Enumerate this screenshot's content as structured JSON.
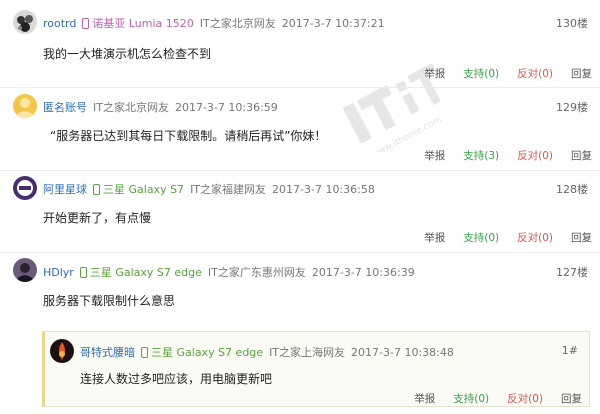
{
  "comments": [
    {
      "user": "rootrd",
      "device": "诺基亚 Lumia 1520",
      "source": "IT之家北京网友",
      "time": "2017-3-7 10:37:21",
      "floor": "130楼",
      "text": "我的一大堆演示机怎么检查不到",
      "report": "举报",
      "support": "支持(0)",
      "oppose": "反对(0)",
      "reply": "回复"
    },
    {
      "user": "匿名账号",
      "device": "",
      "source": "IT之家北京网友",
      "time": "2017-3-7 10:36:59",
      "floor": "129楼",
      "text": "“服务器已达到其每日下载限制。请稍后再试”你妹！",
      "report": "举报",
      "support": "支持(3)",
      "oppose": "反对(0)",
      "reply": "回复"
    },
    {
      "user": "阿里星球",
      "device": "三星 Galaxy S7",
      "source": "IT之家福建网友",
      "time": "2017-3-7 10:36:58",
      "floor": "128楼",
      "text": "开始更新了，有点慢",
      "report": "举报",
      "support": "支持(0)",
      "oppose": "反对(0)",
      "reply": "回复"
    },
    {
      "user": "HDlyr",
      "device": "三星 Galaxy S7 edge",
      "source": "IT之家广东惠州网友",
      "time": "2017-3-7 10:36:39",
      "floor": "127楼",
      "text": "服务器下载限制什么意思",
      "report": "",
      "support": "",
      "oppose": "",
      "reply": ""
    }
  ],
  "reply": {
    "user": "哥特式腰暗",
    "device": "三星 Galaxy S7 edge",
    "source": "IT之家上海网友",
    "time": "2017-3-7 10:38:48",
    "floor": "1#",
    "text": "连接人数过多吧应该，用电脑更新吧",
    "report": "举报",
    "support": "支持(0)",
    "oppose": "反对(0)",
    "reply": "回复"
  },
  "watermark": {
    "brand": "IT之家",
    "url": "www.ithome.com"
  },
  "colors": {
    "link": "#2f6fb5",
    "support": "#3aa04a",
    "oppose": "#e0534e",
    "device_nokia": "#c060b8",
    "device_samsung": "#5aa43a"
  }
}
